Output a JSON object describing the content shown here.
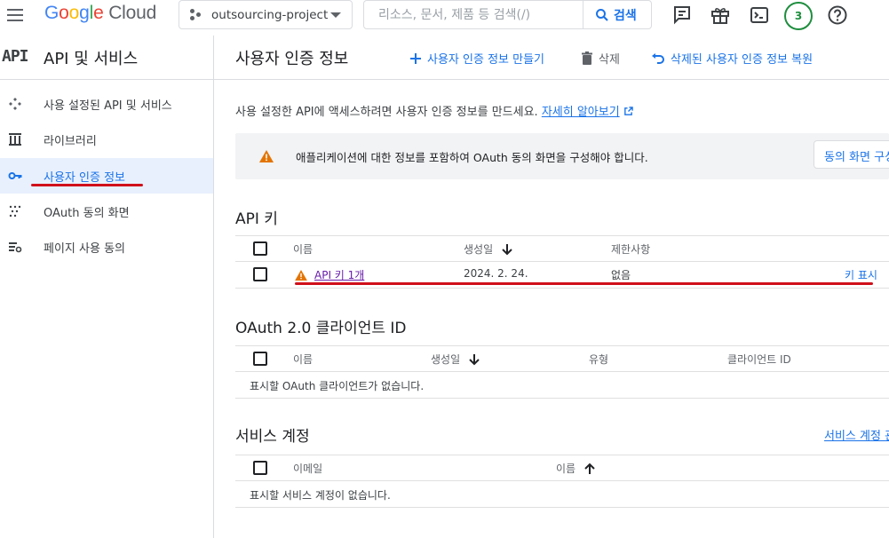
{
  "topbar": {
    "logo_letters": [
      "G",
      "o",
      "o",
      "g",
      "l",
      "e"
    ],
    "logo_product": "Cloud",
    "project_name": "outsourcing-project",
    "search_placeholder": "리소스, 문서, 제품 등 검색(/)",
    "search_button": "검색",
    "notifications_count": "3",
    "icons": [
      "menu-icon",
      "project-dots-icon",
      "dropdown-caret-icon",
      "search-icon",
      "feedback-icon",
      "gift-icon",
      "terminal-icon",
      "help-icon"
    ]
  },
  "sidebar": {
    "api_glyph": "API",
    "title": "API 및 서비스",
    "items": [
      {
        "label": "사용 설정된 API 및 서비스",
        "icon": "enabled-apis-icon",
        "active": false
      },
      {
        "label": "라이브러리",
        "icon": "library-icon",
        "active": false
      },
      {
        "label": "사용자 인증 정보",
        "icon": "key-icon",
        "active": true
      },
      {
        "label": "OAuth 동의 화면",
        "icon": "oauth-consent-icon",
        "active": false
      },
      {
        "label": "페이지 사용 동의",
        "icon": "page-usage-icon",
        "active": false
      }
    ]
  },
  "header": {
    "title": "사용자 인증 정보",
    "create_label": "사용자 인증 정보 만들기",
    "delete_label": "삭제",
    "restore_label": "삭제된 사용자 인증 정보 복원"
  },
  "intro": {
    "text": "사용 설정한 API에 액세스하려면 사용자 인증 정보를 만드세요.",
    "link": "자세히 알아보기"
  },
  "banner": {
    "text": "애플리케이션에 대한 정보를 포함하여 OAuth 동의 화면을 구성해야 합니다.",
    "button": "동의 화면 구성"
  },
  "api_keys": {
    "title": "API 키",
    "columns": [
      "이름",
      "생성일",
      "제한사항"
    ],
    "rows": [
      {
        "name": "API 키 1개",
        "created": "2024. 2. 24.",
        "restrictions": "없음",
        "action": "키 표시"
      }
    ]
  },
  "oauth_clients": {
    "title": "OAuth 2.0 클라이언트 ID",
    "columns": [
      "이름",
      "생성일",
      "유형",
      "클라이언트 ID"
    ],
    "empty": "표시할 OAuth 클라이언트가 없습니다."
  },
  "service_accounts": {
    "title": "서비스 계정",
    "manage_link": "서비스 계정 관리",
    "columns": [
      "이메일",
      "이름"
    ],
    "empty": "표시할 서비스 계정이 없습니다."
  },
  "colors": {
    "accent": "#1a73e8",
    "warning": "#e37400",
    "annotation_red": "#d0101a",
    "badge_green": "#1e8e3e"
  }
}
